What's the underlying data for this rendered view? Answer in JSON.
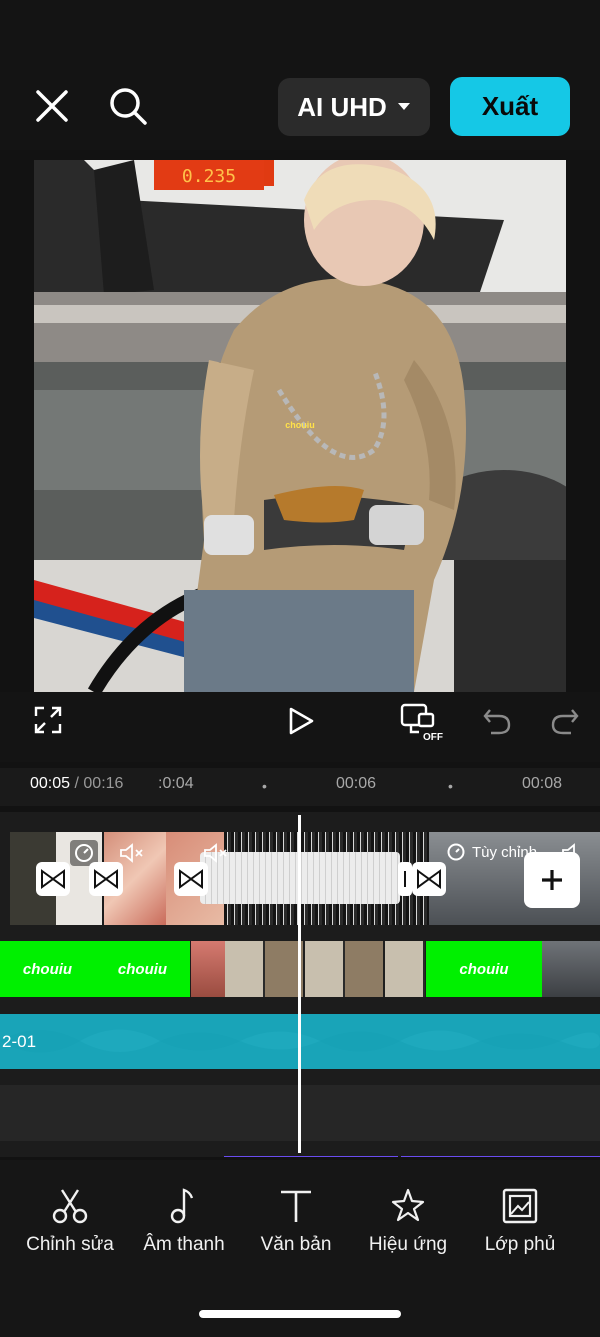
{
  "header": {
    "quality_label": "AI UHD",
    "export_label": "Xuất"
  },
  "preview": {
    "overlay_text": "chouiu",
    "gauge_value": "0.235"
  },
  "playback": {
    "current_time": "00:05",
    "separator": "/",
    "total_time": "00:16"
  },
  "ruler": {
    "ticks": [
      ":0:04",
      "00:06",
      "00:08"
    ]
  },
  "tracks": {
    "clip_badge": "Tùy chỉnh",
    "text_clip_label": "chouiu",
    "audio_label": "2-01"
  },
  "toolbar": {
    "items": [
      "Chỉnh sửa",
      "Âm thanh",
      "Văn bản",
      "Hiệu ứng",
      "Lớp phủ"
    ]
  },
  "colors": {
    "accent": "#15c8e6",
    "green_screen": "#00f000",
    "audio": "#1ea9bd",
    "purple_track": "#6a4cf0"
  }
}
